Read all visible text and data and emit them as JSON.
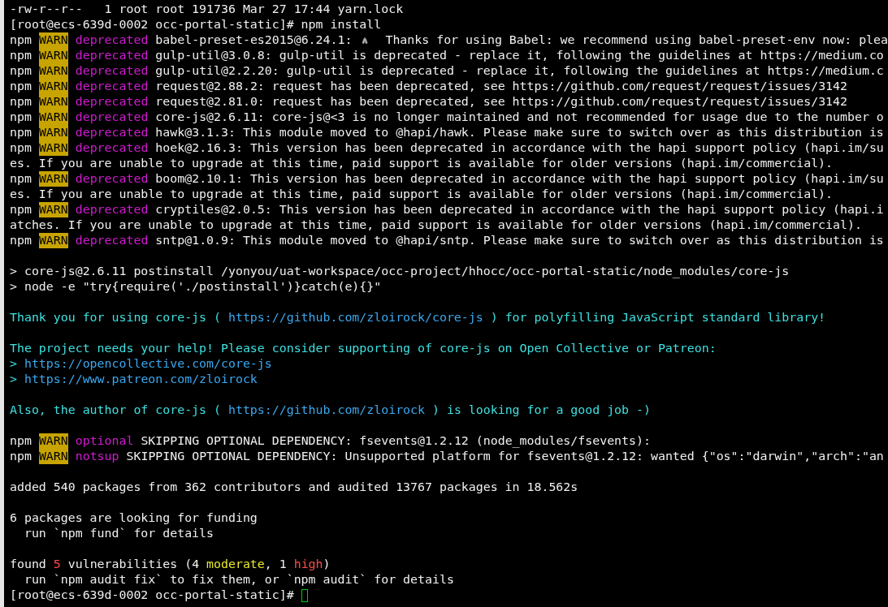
{
  "terminal": {
    "lines": [
      {
        "kind": "text",
        "segments": [
          {
            "kind": "plain",
            "text": "-rw-r--r--   1 root root 191736 Mar 27 17:44 yarn.lock"
          }
        ]
      },
      {
        "kind": "text",
        "segments": [
          {
            "kind": "plain",
            "text": "[root@ecs-639d-0002 occ-portal-static]# npm install"
          }
        ]
      },
      {
        "kind": "text",
        "segments": [
          {
            "kind": "plain",
            "text": "npm "
          },
          {
            "kind": "warn",
            "text": "WARN"
          },
          {
            "kind": "deprecated",
            "text": " deprecated"
          },
          {
            "kind": "plain",
            "text": " babel-preset-es2015@6.24.1: "
          },
          {
            "kind": "icon"
          },
          {
            "kind": "plain",
            "text": "  Thanks for using Babel: we recommend using babel-preset-env now: plea"
          }
        ]
      },
      {
        "kind": "text",
        "segments": [
          {
            "kind": "plain",
            "text": "npm "
          },
          {
            "kind": "warn",
            "text": "WARN"
          },
          {
            "kind": "deprecated",
            "text": " deprecated"
          },
          {
            "kind": "plain",
            "text": " gulp-util@3.0.8: gulp-util is deprecated - replace it, following the guidelines at https://medium.co"
          }
        ]
      },
      {
        "kind": "text",
        "segments": [
          {
            "kind": "plain",
            "text": "npm "
          },
          {
            "kind": "warn",
            "text": "WARN"
          },
          {
            "kind": "deprecated",
            "text": " deprecated"
          },
          {
            "kind": "plain",
            "text": " gulp-util@2.2.20: gulp-util is deprecated - replace it, following the guidelines at https://medium.c"
          }
        ]
      },
      {
        "kind": "text",
        "segments": [
          {
            "kind": "plain",
            "text": "npm "
          },
          {
            "kind": "warn",
            "text": "WARN"
          },
          {
            "kind": "deprecated",
            "text": " deprecated"
          },
          {
            "kind": "plain",
            "text": " request@2.88.2: request has been deprecated, see https://github.com/request/request/issues/3142"
          }
        ]
      },
      {
        "kind": "text",
        "segments": [
          {
            "kind": "plain",
            "text": "npm "
          },
          {
            "kind": "warn",
            "text": "WARN"
          },
          {
            "kind": "deprecated",
            "text": " deprecated"
          },
          {
            "kind": "plain",
            "text": " request@2.81.0: request has been deprecated, see https://github.com/request/request/issues/3142"
          }
        ]
      },
      {
        "kind": "text",
        "segments": [
          {
            "kind": "plain",
            "text": "npm "
          },
          {
            "kind": "warn",
            "text": "WARN"
          },
          {
            "kind": "deprecated",
            "text": " deprecated"
          },
          {
            "kind": "plain",
            "text": " core-js@2.6.11: core-js@<3 is no longer maintained and not recommended for usage due to the number o"
          }
        ]
      },
      {
        "kind": "text",
        "segments": [
          {
            "kind": "plain",
            "text": "npm "
          },
          {
            "kind": "warn",
            "text": "WARN"
          },
          {
            "kind": "deprecated",
            "text": " deprecated"
          },
          {
            "kind": "plain",
            "text": " hawk@3.1.3: This module moved to @hapi/hawk. Please make sure to switch over as this distribution is"
          }
        ]
      },
      {
        "kind": "text",
        "segments": [
          {
            "kind": "plain",
            "text": "npm "
          },
          {
            "kind": "warn",
            "text": "WARN"
          },
          {
            "kind": "deprecated",
            "text": " deprecated"
          },
          {
            "kind": "plain",
            "text": " hoek@2.16.3: This version has been deprecated in accordance with the hapi support policy (hapi.im/su"
          }
        ]
      },
      {
        "kind": "text",
        "segments": [
          {
            "kind": "plain",
            "text": "es. If you are unable to upgrade at this time, paid support is available for older versions (hapi.im/commercial)."
          }
        ]
      },
      {
        "kind": "text",
        "segments": [
          {
            "kind": "plain",
            "text": "npm "
          },
          {
            "kind": "warn",
            "text": "WARN"
          },
          {
            "kind": "deprecated",
            "text": " deprecated"
          },
          {
            "kind": "plain",
            "text": " boom@2.10.1: This version has been deprecated in accordance with the hapi support policy (hapi.im/su"
          }
        ]
      },
      {
        "kind": "text",
        "segments": [
          {
            "kind": "plain",
            "text": "es. If you are unable to upgrade at this time, paid support is available for older versions (hapi.im/commercial)."
          }
        ]
      },
      {
        "kind": "text",
        "segments": [
          {
            "kind": "plain",
            "text": "npm "
          },
          {
            "kind": "warn",
            "text": "WARN"
          },
          {
            "kind": "deprecated",
            "text": " deprecated"
          },
          {
            "kind": "plain",
            "text": " cryptiles@2.0.5: This version has been deprecated in accordance with the hapi support policy (hapi.i"
          }
        ]
      },
      {
        "kind": "text",
        "segments": [
          {
            "kind": "plain",
            "text": "atches. If you are unable to upgrade at this time, paid support is available for older versions (hapi.im/commercial)."
          }
        ]
      },
      {
        "kind": "text",
        "segments": [
          {
            "kind": "plain",
            "text": "npm "
          },
          {
            "kind": "warn",
            "text": "WARN"
          },
          {
            "kind": "deprecated",
            "text": " deprecated"
          },
          {
            "kind": "plain",
            "text": " sntp@1.0.9: This module moved to @hapi/sntp. Please make sure to switch over as this distribution is"
          }
        ]
      },
      {
        "kind": "blank"
      },
      {
        "kind": "text",
        "segments": [
          {
            "kind": "plain",
            "text": "> core-js@2.6.11 postinstall /yonyou/uat-workspace/occ-project/hhocc/occ-portal-static/node_modules/core-js"
          }
        ]
      },
      {
        "kind": "text",
        "segments": [
          {
            "kind": "plain",
            "text": "> node -e \"try{require('./postinstall')}catch(e){}\""
          }
        ]
      },
      {
        "kind": "blank"
      },
      {
        "kind": "text",
        "segments": [
          {
            "kind": "cyan",
            "text": "Thank you for using core-js ( "
          },
          {
            "kind": "link",
            "text": "https://github.com/zloirock/core-js"
          },
          {
            "kind": "cyan",
            "text": " ) for polyfilling JavaScript standard library!"
          }
        ]
      },
      {
        "kind": "blank"
      },
      {
        "kind": "text",
        "segments": [
          {
            "kind": "cyan",
            "text": "The project needs your help! Please consider supporting of core-js on Open Collective or Patreon:"
          }
        ]
      },
      {
        "kind": "text",
        "segments": [
          {
            "kind": "cyan",
            "text": "> "
          },
          {
            "kind": "link",
            "text": "https://opencollective.com/core-js"
          }
        ]
      },
      {
        "kind": "text",
        "segments": [
          {
            "kind": "cyan",
            "text": "> "
          },
          {
            "kind": "link",
            "text": "https://www.patreon.com/zloirock"
          }
        ]
      },
      {
        "kind": "blank"
      },
      {
        "kind": "text",
        "segments": [
          {
            "kind": "cyan",
            "text": "Also, the author of core-js ( "
          },
          {
            "kind": "link",
            "text": "https://github.com/zloirock"
          },
          {
            "kind": "cyan",
            "text": " ) is looking for a good job -)"
          }
        ]
      },
      {
        "kind": "blank"
      },
      {
        "kind": "text",
        "segments": [
          {
            "kind": "plain",
            "text": "npm "
          },
          {
            "kind": "warn",
            "text": "WARN"
          },
          {
            "kind": "deprecated",
            "text": " optional"
          },
          {
            "kind": "plain",
            "text": " SKIPPING OPTIONAL DEPENDENCY: fsevents@1.2.12 (node_modules/fsevents):"
          }
        ]
      },
      {
        "kind": "text",
        "segments": [
          {
            "kind": "plain",
            "text": "npm "
          },
          {
            "kind": "warn",
            "text": "WARN"
          },
          {
            "kind": "deprecated",
            "text": " notsup"
          },
          {
            "kind": "plain",
            "text": " SKIPPING OPTIONAL DEPENDENCY: Unsupported platform for fsevents@1.2.12: wanted {\"os\":\"darwin\",\"arch\":\"an"
          }
        ]
      },
      {
        "kind": "blank"
      },
      {
        "kind": "text",
        "segments": [
          {
            "kind": "plain",
            "text": "added 540 packages from 362 contributors and audited 13767 packages in 18.562s"
          }
        ]
      },
      {
        "kind": "blank"
      },
      {
        "kind": "text",
        "segments": [
          {
            "kind": "plain",
            "text": "6 packages are looking for funding"
          }
        ]
      },
      {
        "kind": "text",
        "segments": [
          {
            "kind": "plain",
            "text": "  run `npm fund` for details"
          }
        ]
      },
      {
        "kind": "blank"
      },
      {
        "kind": "text",
        "segments": [
          {
            "kind": "plain",
            "text": "found "
          },
          {
            "kind": "red",
            "text": "5"
          },
          {
            "kind": "plain",
            "text": " vulnerabilities (4 "
          },
          {
            "kind": "yellow",
            "text": "moderate"
          },
          {
            "kind": "plain",
            "text": ", 1 "
          },
          {
            "kind": "red",
            "text": "high"
          },
          {
            "kind": "plain",
            "text": ")"
          }
        ]
      },
      {
        "kind": "text",
        "segments": [
          {
            "kind": "plain",
            "text": "  run `npm audit fix` to fix them, or `npm audit` for details"
          }
        ]
      },
      {
        "kind": "prompt",
        "segments": [
          {
            "kind": "plain",
            "text": "[root@ecs-639d-0002 occ-portal-static]# "
          }
        ]
      }
    ]
  }
}
